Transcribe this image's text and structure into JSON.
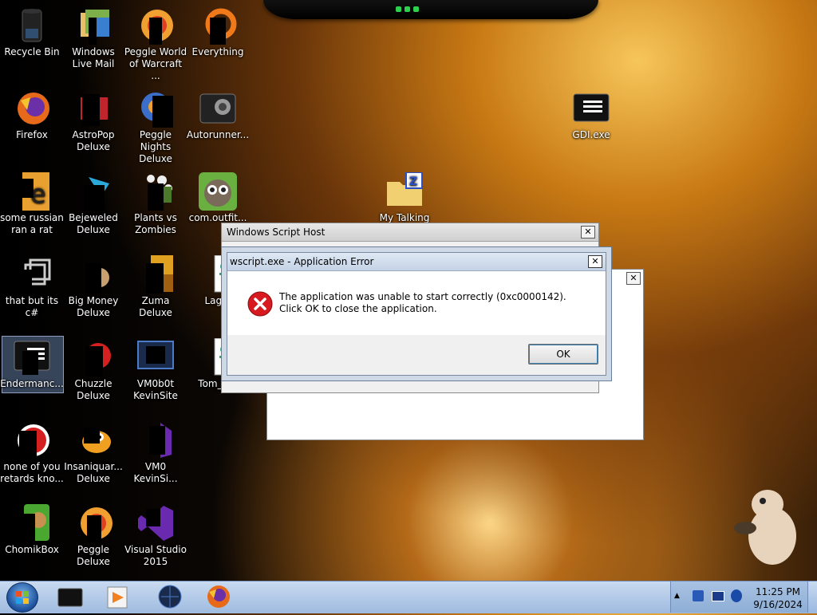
{
  "desktop_icons": [
    {
      "label": "Recycle Bin",
      "icon": "recycle-bin-icon"
    },
    {
      "label": "Windows Live Mail",
      "icon": "windows-live-mail-icon"
    },
    {
      "label": "Peggle World of Warcraft ...",
      "icon": "peggle-world-of-warcraft-icon"
    },
    {
      "label": "Everything",
      "icon": "everything-icon"
    },
    {
      "label": "Firefox",
      "icon": "firefox-icon"
    },
    {
      "label": "AstroPop Deluxe",
      "icon": "astropop-icon"
    },
    {
      "label": "Peggle Nights Deluxe",
      "icon": "peggle-nights-icon"
    },
    {
      "label": "Autorunner...",
      "icon": "autorunner-icon"
    },
    {
      "label": "GDI.exe",
      "icon": "gdi-exe-icon"
    },
    {
      "label": "some russian ran a rat",
      "icon": "russian-rat-icon"
    },
    {
      "label": "Bejeweled Deluxe",
      "icon": "bejeweled-icon"
    },
    {
      "label": "Plants vs Zombies",
      "icon": "plants-vs-zombies-icon"
    },
    {
      "label": "com.outfit...",
      "icon": "talking-tom-icon"
    },
    {
      "label": "My Talking",
      "icon": "zip-folder-icon"
    },
    {
      "label": "that but its c#",
      "icon": "shortcut-icon"
    },
    {
      "label": "Big Money Deluxe",
      "icon": "big-money-icon"
    },
    {
      "label": "Zuma Deluxe",
      "icon": "zuma-icon"
    },
    {
      "label": "Lag...",
      "icon": "script-file-icon"
    },
    {
      "label": "Endermanc...",
      "icon": "endermanch-icon"
    },
    {
      "label": "Chuzzle Deluxe",
      "icon": "chuzzle-icon"
    },
    {
      "label": "VM0b0t KevinSite",
      "icon": "vm0b0t-icon"
    },
    {
      "label": "Tom_1...",
      "icon": "script-file-icon"
    },
    {
      "label": "none of you retards kno...",
      "icon": "chrome-like-icon"
    },
    {
      "label": "Insaniquar... Deluxe",
      "icon": "insaniquarium-icon"
    },
    {
      "label": "VM0 KevinSi...",
      "icon": "vm0-icon"
    },
    {
      "label": "ChomikBox",
      "icon": "chomikbox-icon"
    },
    {
      "label": "Peggle Deluxe",
      "icon": "peggle-deluxe-icon"
    },
    {
      "label": "Visual Studio 2015",
      "icon": "visual-studio-icon"
    }
  ],
  "script_host_dialog": {
    "title": "Windows Script Host"
  },
  "error_dialog": {
    "title": "wscript.exe - Application Error",
    "message": "The application was unable to start correctly (0xc0000142). Click OK to close the application.",
    "ok_label": "OK"
  },
  "taskbar": {
    "clock_time": "11:25 PM",
    "clock_date": "9/16/2024",
    "pinned": [
      "start-orb-icon",
      "terminal-icon",
      "media-player-icon",
      "globe-icon",
      "firefox-icon"
    ]
  },
  "colors": {
    "error_red": "#d71920",
    "accent_blue": "#3a6ea5"
  }
}
